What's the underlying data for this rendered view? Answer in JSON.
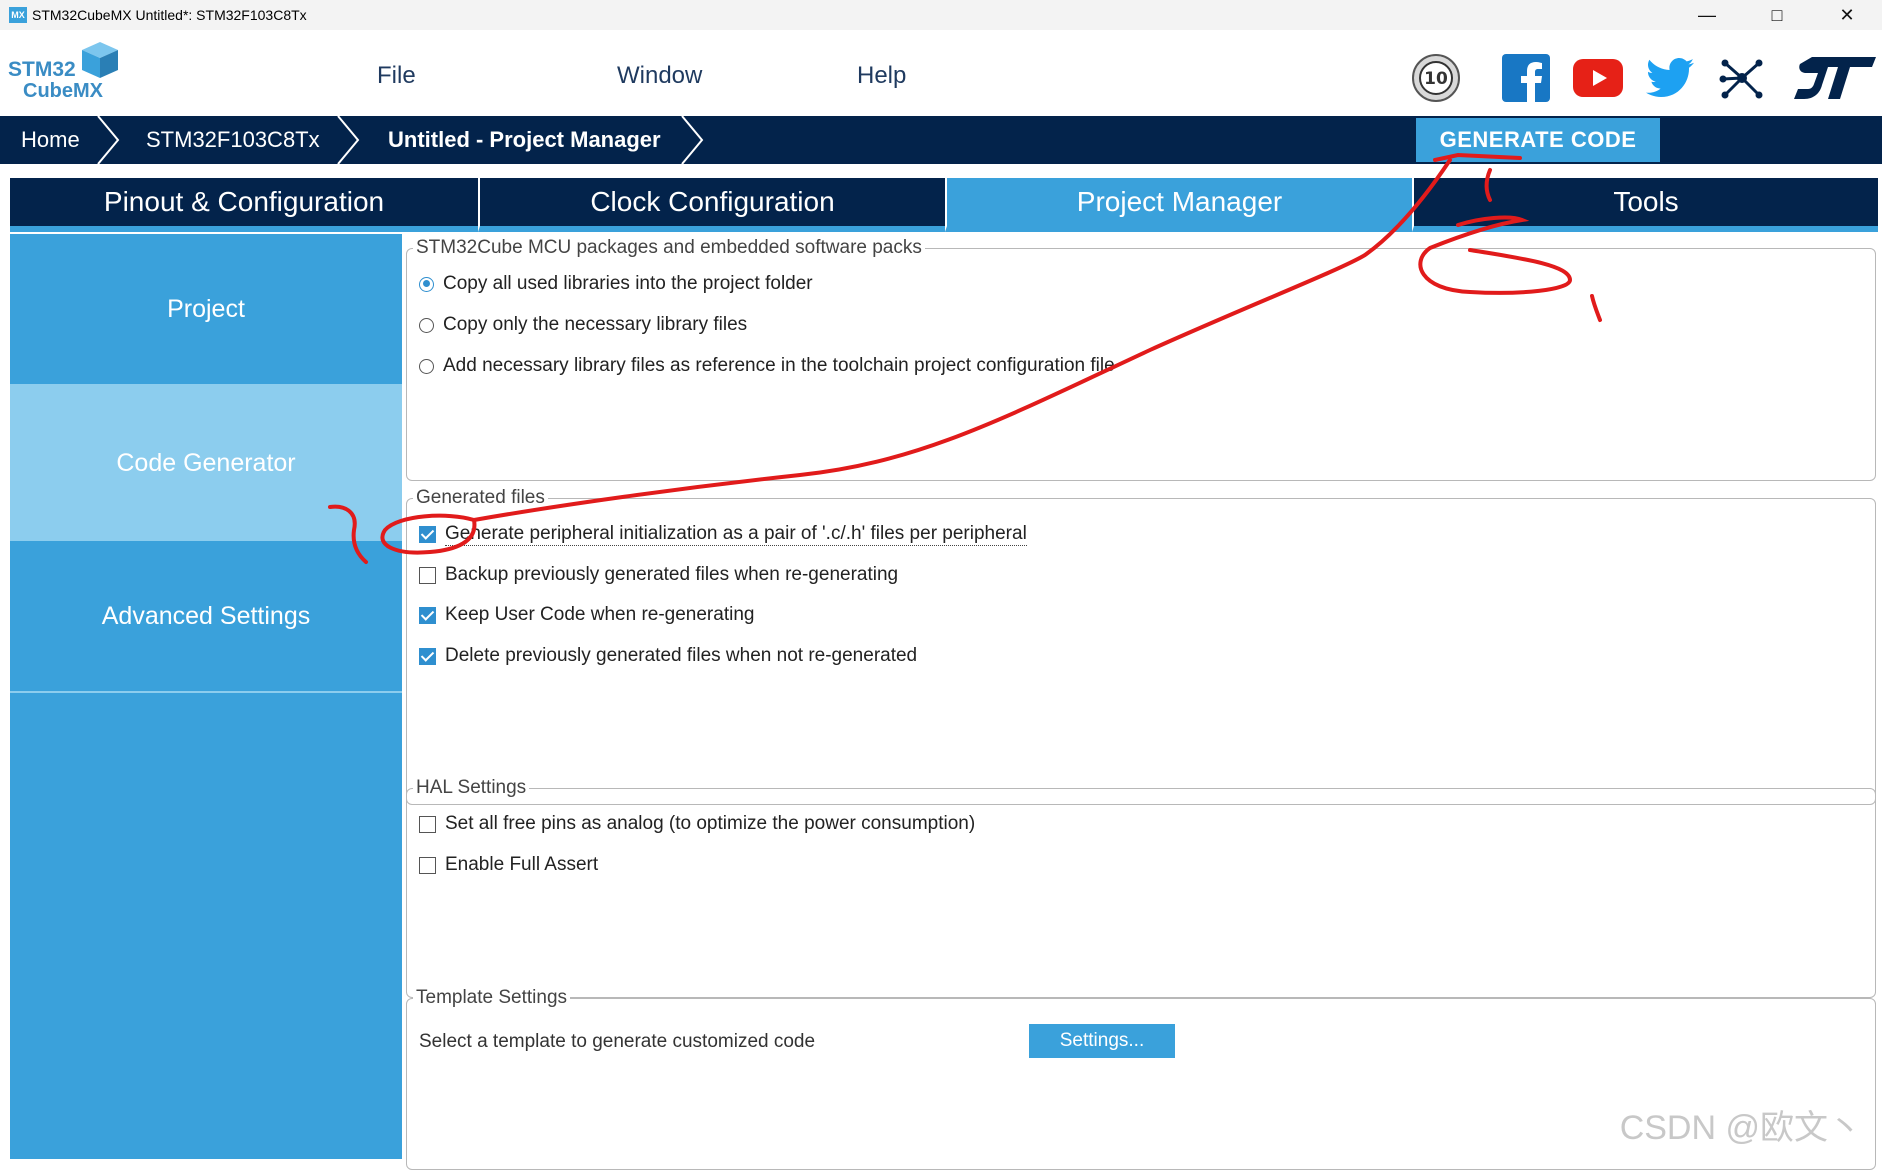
{
  "window": {
    "app_badge": "MX",
    "title": "STM32CubeMX Untitled*: STM32F103C8Tx"
  },
  "logo": {
    "line1": "STM32",
    "line2": "CubeMX"
  },
  "menu": [
    "File",
    "Window",
    "Help"
  ],
  "social_icons": [
    "anniversary-10-badge-icon",
    "facebook-icon",
    "youtube-icon",
    "twitter-icon",
    "network-icon",
    "st-logo-icon"
  ],
  "badge_number": "10",
  "breadcrumb": [
    "Home",
    "STM32F103C8Tx",
    "Untitled - Project Manager"
  ],
  "generate_button": "GENERATE CODE",
  "tabs": [
    "Pinout & Configuration",
    "Clock Configuration",
    "Project Manager",
    "Tools"
  ],
  "active_tab": "Project Manager",
  "sidebar": [
    "Project",
    "Code Generator",
    "Advanced Settings"
  ],
  "active_sidebar": "Code Generator",
  "groups": {
    "packages": {
      "title": "STM32Cube MCU packages and embedded software packs",
      "options": [
        {
          "label": "Copy all used libraries into the project folder",
          "selected": true
        },
        {
          "label": "Copy only the necessary library files",
          "selected": false
        },
        {
          "label": "Add necessary library files as reference in the toolchain project configuration file",
          "selected": false
        }
      ]
    },
    "generated": {
      "title": "Generated files",
      "options": [
        {
          "label": "Generate peripheral initialization as a pair of '.c/.h' files per peripheral",
          "checked": true
        },
        {
          "label": "Backup previously generated files when re-generating",
          "checked": false
        },
        {
          "label": "Keep User Code when re-generating",
          "checked": true
        },
        {
          "label": "Delete previously generated files when not re-generated",
          "checked": true
        }
      ]
    },
    "hal": {
      "title": "HAL Settings",
      "options": [
        {
          "label": "Set all free pins as analog (to optimize the power consumption)",
          "checked": false
        },
        {
          "label": "Enable Full Assert",
          "checked": false
        }
      ]
    },
    "template": {
      "title": "Template Settings",
      "label": "Select a template to generate customized code",
      "button": "Settings..."
    }
  },
  "watermark": "CSDN @欧文丶",
  "colors": {
    "navy": "#03234b",
    "accent": "#3aa1db",
    "sidebar_active": "#8ccdee",
    "annotation": "#e11b1b"
  }
}
